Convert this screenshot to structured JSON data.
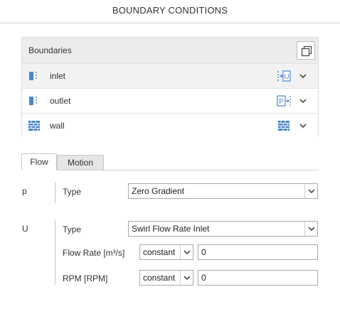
{
  "page": {
    "title": "BOUNDARY CONDITIONS"
  },
  "boundaries": {
    "header_label": "Boundaries",
    "copy_icon": "copy-icon",
    "items": [
      {
        "label": "inlet",
        "icon": "patch-icon",
        "type_badge": "U",
        "type_icon": "velocity-inlet-icon",
        "selected": true
      },
      {
        "label": "outlet",
        "icon": "patch-icon",
        "type_badge": "P",
        "type_icon": "pressure-outlet-icon",
        "selected": false
      },
      {
        "label": "wall",
        "icon": "wall-icon",
        "type_icon": "wall-icon",
        "selected": false
      }
    ]
  },
  "tabs": [
    {
      "label": "Flow",
      "active": true
    },
    {
      "label": "Motion",
      "active": false
    }
  ],
  "flow": {
    "p": {
      "symbol": "p",
      "type_label": "Type",
      "type_value": "Zero Gradient"
    },
    "U": {
      "symbol": "U",
      "type_label": "Type",
      "type_value": "Swirl Flow Rate Inlet",
      "flow_rate_label": "Flow Rate [m³/s]",
      "flow_rate_mode": "constant",
      "flow_rate_value": "0",
      "rpm_label": "RPM [RPM]",
      "rpm_mode": "constant",
      "rpm_value": "0"
    }
  },
  "colors": {
    "accent": "#4a86c8",
    "panel_header": "#ececec",
    "selected_row": "#f2f2f2",
    "border": "#dcdcdc"
  }
}
